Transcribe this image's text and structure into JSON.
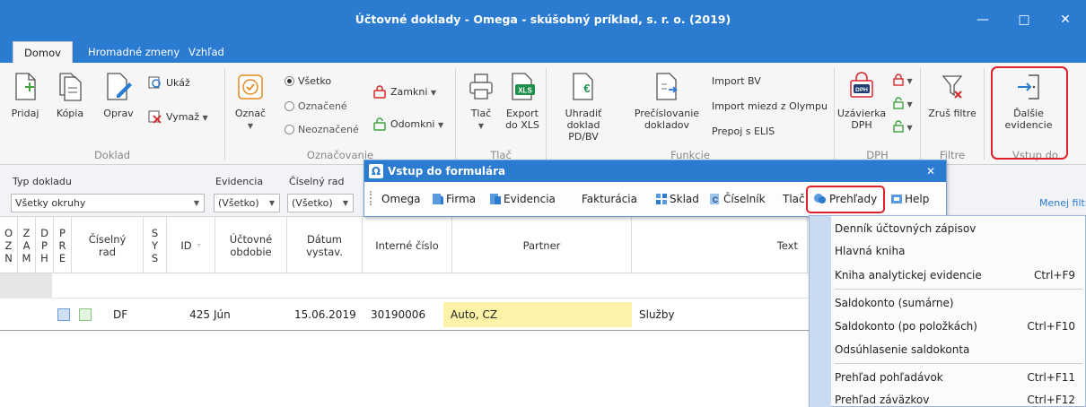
{
  "window": {
    "title": "Účtovné doklady - Omega - skúšobný príklad, s. r. o. (2019)",
    "minimize": "—",
    "maximize": "□",
    "close": "✕"
  },
  "tabs": [
    {
      "label": "Domov"
    },
    {
      "label": "Hromadné zmeny"
    },
    {
      "label": "Vzhľad"
    }
  ],
  "ribbon": {
    "doklad": {
      "label": "Doklad",
      "pridaj": "Pridaj",
      "kopia": "Kópia",
      "oprav": "Oprav",
      "ukaz": "Ukáž",
      "vymaz": "Vymaž"
    },
    "oznacovanie": {
      "label": "Označovanie",
      "oznac": "Označ",
      "vsetko": "Všetko",
      "oznacene": "Označené",
      "neoznacene": "Neoznačené",
      "zamkni": "Zamkni",
      "odomkni": "Odomkni"
    },
    "tlac": {
      "label": "Tlač",
      "tlac": "Tlač",
      "export": "Export do XLS",
      "export_line1": "Export",
      "export_line2": "do XLS",
      "xls_badge": "XLS"
    },
    "funkcie": {
      "label": "Funkcie",
      "uhradit_line1": "Uhradiť",
      "uhradit_line2": "doklad PD/BV",
      "preciselovanie_line1": "Prečíslovanie",
      "preciselovanie_line2": "dokladov",
      "import_bv": "Import BV",
      "import_miezd": "Import miezd z Olympu",
      "prepoj": "Prepoj s ELIS"
    },
    "dph": {
      "label": "DPH",
      "uzavierka_line1": "Uzávierka",
      "uzavierka_line2": "DPH",
      "badge": "DPH"
    },
    "filtre": {
      "label": "Filtre",
      "zrus": "Zruš filtre"
    },
    "vstup": {
      "label": "Vstup do",
      "dalsie_line1": "Ďalšie",
      "dalsie_line2": "evidencie"
    }
  },
  "filters": {
    "typ": {
      "label": "Typ dokladu",
      "value": "Všetky okruhy"
    },
    "evidencia": {
      "label": "Evidencia",
      "value": "(Všetko)"
    },
    "ciselny": {
      "label": "Číselný rad",
      "value": "(Všetko)"
    },
    "menej": "Menej filtrov"
  },
  "grid": {
    "headers": {
      "ozn": "O\nZ\nN",
      "zam": "Z\nA\nM",
      "dph": "D\nP\nH",
      "pre": "P\nR\nE",
      "ciselny": "Číselný\nrad",
      "sys": "S\nY\nS",
      "id": "ID",
      "obdobie": "Účtovné\nobdobie",
      "datum": "Dátum\nvystav.",
      "interne": "Interné číslo",
      "partner": "Partner",
      "text": "Text"
    },
    "rows": [
      {
        "ciselny": "DF",
        "id": "425",
        "obdobie": "Jún",
        "datum": "15.06.2019",
        "interne": "30190006",
        "partner": "Auto, CZ",
        "text": "Služby"
      }
    ]
  },
  "dialog": {
    "title": "Vstup do formulára",
    "close": "✕",
    "menu": [
      {
        "label": "Omega"
      },
      {
        "label": "Firma"
      },
      {
        "label": "Evidencia"
      },
      {
        "label": "Fakturácia"
      },
      {
        "label": "Sklad"
      },
      {
        "label": "Číselník"
      },
      {
        "label": "Tlač"
      },
      {
        "label": "Prehľady"
      },
      {
        "label": "Help"
      }
    ]
  },
  "dropdown": [
    {
      "label": "Denník účtovných zápisov",
      "shortcut": ""
    },
    {
      "label": "Hlavná kniha",
      "shortcut": ""
    },
    {
      "label": "Kniha analytickej evidencie",
      "shortcut": "Ctrl+F9"
    },
    {
      "label": "Saldokonto (sumárne)",
      "shortcut": ""
    },
    {
      "label": "Saldokonto (po položkách)",
      "shortcut": "Ctrl+F10"
    },
    {
      "label": "Odsúhlasenie saldokonta",
      "shortcut": ""
    },
    {
      "label": "Prehľad pohľadávok",
      "shortcut": "Ctrl+F11"
    },
    {
      "label": "Prehľad záväzkov",
      "shortcut": "Ctrl+F12"
    }
  ],
  "colors": {
    "titlebar": "#2b7bd0",
    "highlight": "#e0202a",
    "partner_bg": "#fdf3a8",
    "accent_green": "#3fa33f"
  }
}
